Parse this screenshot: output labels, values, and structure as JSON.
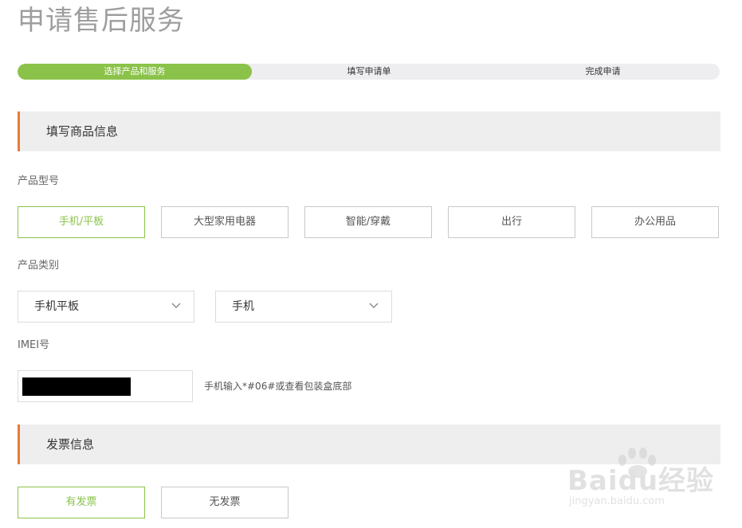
{
  "page": {
    "title": "申请售后服务"
  },
  "progress": {
    "current_step": 1,
    "steps": [
      "选择产品和服务",
      "填写申请单",
      "完成申请"
    ]
  },
  "section_product": {
    "title": "填写商品信息"
  },
  "product_model": {
    "label": "产品型号",
    "options": [
      "手机/平板",
      "大型家用电器",
      "智能/穿戴",
      "出行",
      "办公用品"
    ],
    "selected": "手机/平板"
  },
  "product_category": {
    "label": "产品类别",
    "select1_value": "手机平板",
    "select2_value": "手机"
  },
  "imei": {
    "label": "IMEI号",
    "hint": "手机输入*#06#或查看包装盒底部"
  },
  "section_invoice": {
    "title": "发票信息"
  },
  "invoice": {
    "options": [
      "有发票",
      "无发票"
    ],
    "selected": "有发票"
  },
  "watermark": {
    "text": "Baidu经验",
    "sub": "jingyan.baidu.com"
  },
  "colors": {
    "accent": "#8bc34a",
    "section_marker": "#e87a3a"
  }
}
